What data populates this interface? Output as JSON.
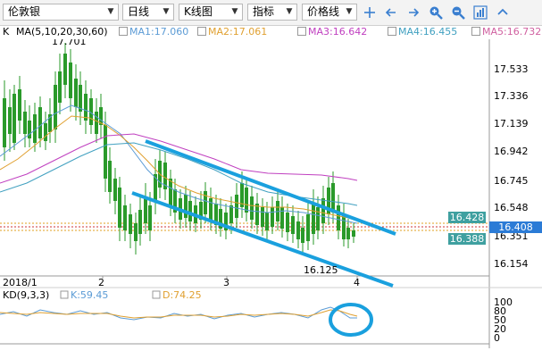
{
  "toolbar": {
    "symbol": "伦敦银",
    "period": "日线",
    "chart_type": "K线图",
    "indicator": "指标",
    "line_type": "价格线"
  },
  "indicators": {
    "mode": "K",
    "ma_label": "MA(5,10,20,30,60)",
    "ma1": "MA1:17.060",
    "ma2": "MA2:17.061",
    "ma3": "MA3:16.642",
    "ma4": "MA4:16.455",
    "ma5": "MA5:16.732",
    "colors": {
      "ma1": "#5b9bd5",
      "ma2": "#e0a030",
      "ma3": "#c040c0",
      "ma4": "#40a0c0",
      "ma5": "#d060a0"
    }
  },
  "annotations": {
    "high": "17.701",
    "low": "16.125"
  },
  "price_axis": [
    "17.533",
    "17.336",
    "17.139",
    "16.942",
    "16.745",
    "16.548",
    "16.351",
    "16.154"
  ],
  "price_tags": [
    {
      "text": "16.428",
      "color": "#3fa0a0"
    },
    {
      "text": "16.408",
      "color": "#2b7bd6"
    },
    {
      "text": "16.388",
      "color": "#3fa0a0"
    }
  ],
  "date_axis": {
    "start": "2018/1",
    "labels": [
      "2",
      "3",
      "4"
    ]
  },
  "kd": {
    "label": "KD(9,3,3)",
    "k": "K:59.45",
    "d": "D:74.25",
    "axis": [
      "100",
      "80",
      "50",
      "20",
      "0"
    ],
    "k_color": "#5b9bd5",
    "d_color": "#e0a030"
  }
}
